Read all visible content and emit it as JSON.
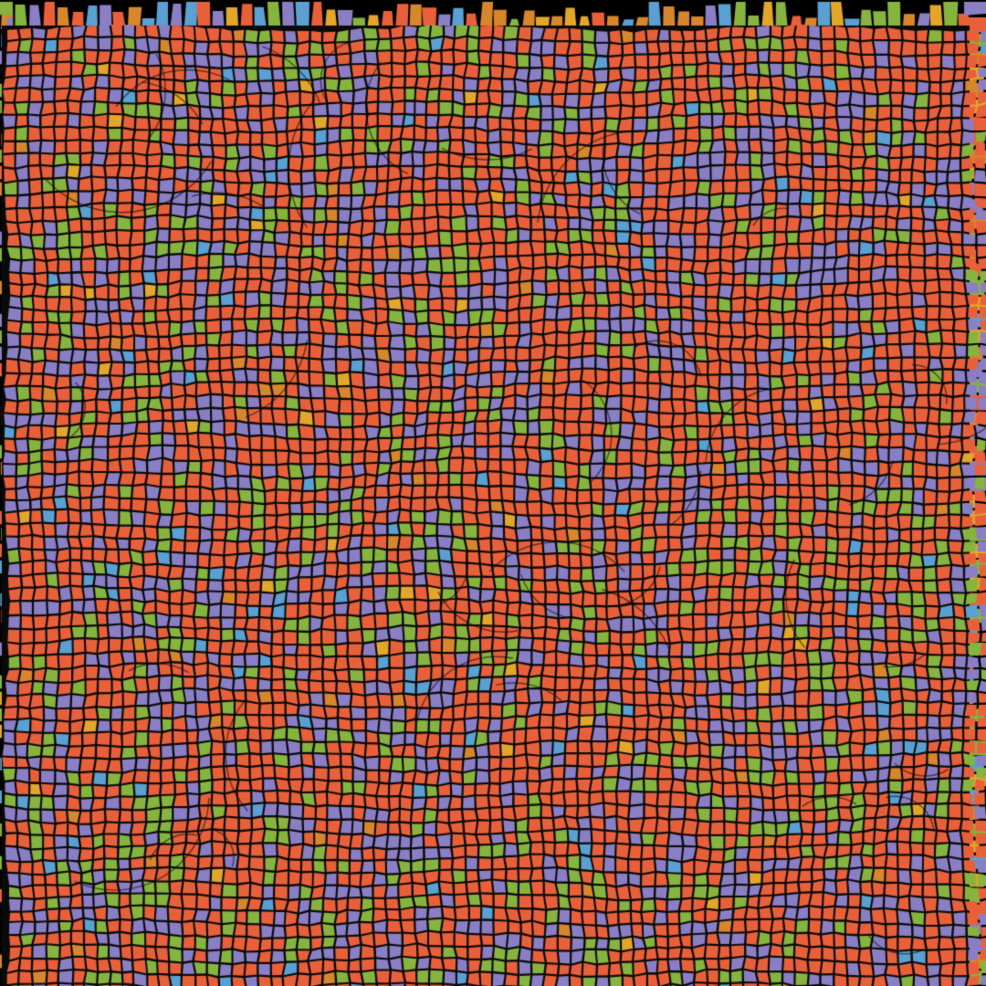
{
  "artwork": {
    "background_color": "#000000",
    "grout_color": "#0a0a0a",
    "palette": {
      "orange": "#e8603a",
      "purple": "#8a7ec4",
      "green": "#86b43e",
      "blue": "#5aa0d2",
      "gold": "#e3a62a",
      "amber": "#d7862c"
    },
    "tile_mix": {
      "orange": 0.56,
      "purple": 0.24,
      "green": 0.16,
      "blue": 0.02,
      "gold": 0.01,
      "amber": 0.01
    },
    "style": "voronoi-mosaic",
    "edge_rays": [
      "top",
      "left",
      "right"
    ]
  }
}
